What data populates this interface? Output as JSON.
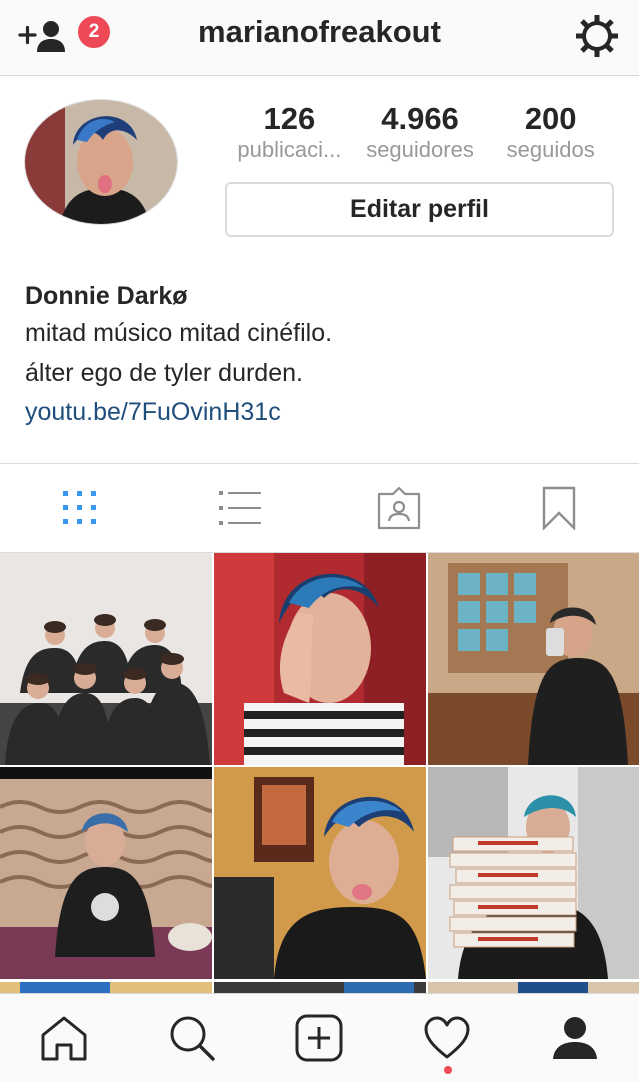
{
  "header": {
    "username": "marianofreakout",
    "friend_requests_count": "2",
    "add_friend_icon": "add-person-icon",
    "settings_icon": "gear-icon"
  },
  "profile": {
    "stats": [
      {
        "value": "126",
        "label": "publicaci..."
      },
      {
        "value": "4.966",
        "label": "seguidores"
      },
      {
        "value": "200",
        "label": "seguidos"
      }
    ],
    "edit_button_label": "Editar perfil",
    "display_name": "Donnie Darkø",
    "bio_lines": [
      "mitad músico mitad cinéfilo.",
      "álter ego de tyler durden."
    ],
    "link": "youtu.be/7FuOvinH31c"
  },
  "tabs": [
    {
      "name": "grid-view",
      "icon": "grid-icon",
      "active": true
    },
    {
      "name": "list-view",
      "icon": "list-icon",
      "active": false
    },
    {
      "name": "tagged",
      "icon": "tagged-photo-icon",
      "active": false
    },
    {
      "name": "saved",
      "icon": "bookmark-icon",
      "active": false
    }
  ],
  "grid_photos": [
    {
      "id": "photo-1",
      "subject": "band group photo"
    },
    {
      "id": "photo-2",
      "subject": "selfie hand over face"
    },
    {
      "id": "photo-3",
      "subject": "mirror selfie"
    },
    {
      "id": "photo-4",
      "subject": "sitting on couch"
    },
    {
      "id": "photo-5",
      "subject": "selfie tongue out"
    },
    {
      "id": "photo-6",
      "subject": "holding pizza boxes"
    }
  ],
  "bottom_nav": [
    {
      "name": "home",
      "icon": "home-icon"
    },
    {
      "name": "search",
      "icon": "search-icon"
    },
    {
      "name": "new-post",
      "icon": "add-post-icon"
    },
    {
      "name": "activity",
      "icon": "heart-icon",
      "has_notification": true
    },
    {
      "name": "profile",
      "icon": "profile-icon",
      "active": true
    }
  ],
  "colors": {
    "accent": "#3897f0",
    "link": "#1f4e7d",
    "badge": "#ed4956",
    "text": "#262626",
    "muted": "#999999"
  }
}
